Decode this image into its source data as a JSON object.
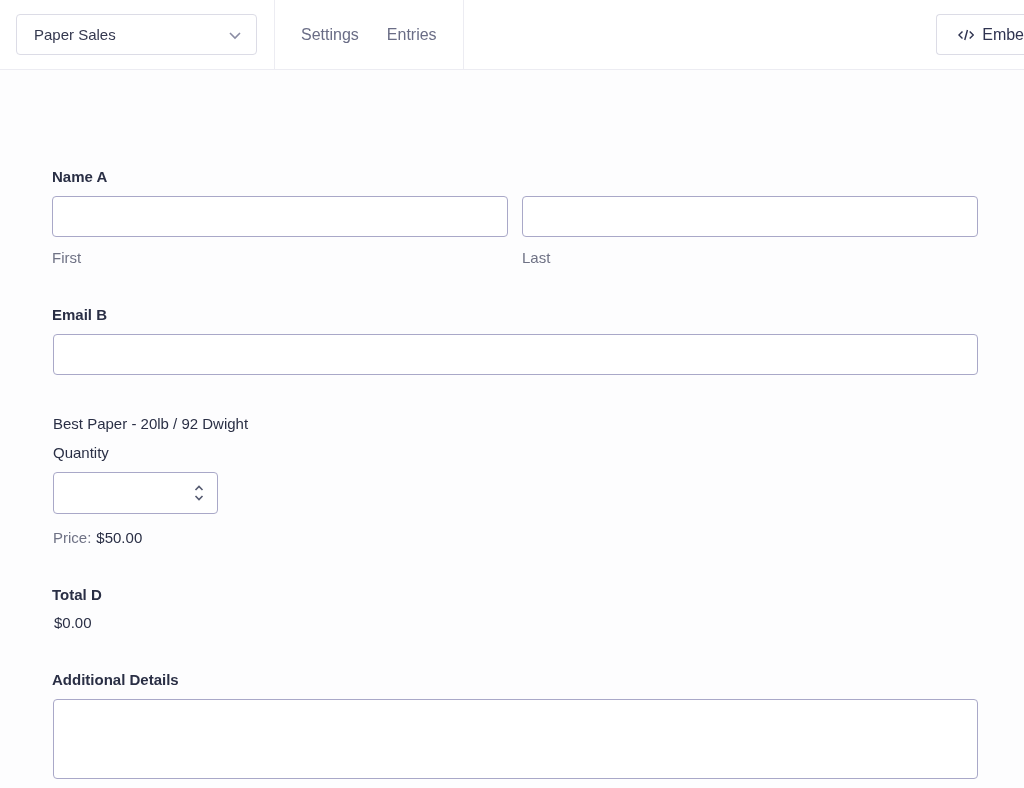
{
  "header": {
    "form_select": {
      "value": "Paper Sales"
    },
    "tabs": [
      {
        "label": "Settings",
        "selected": false
      },
      {
        "label": "Entries",
        "selected": false
      }
    ],
    "embed_button": {
      "label": "Embe"
    }
  },
  "fields": [
    {
      "kind": "name",
      "label": "Name A",
      "parts": [
        {
          "sublabel": "First"
        },
        {
          "sublabel": "Last"
        }
      ]
    },
    {
      "kind": "email",
      "label": "Email B"
    },
    {
      "kind": "product",
      "label": "Best Paper - 20lb / 92 Dwight",
      "quantity_label": "Quantity",
      "price_label": "Price:",
      "price": "$50.00"
    },
    {
      "kind": "total",
      "label": "Total D",
      "value": "$0.00"
    },
    {
      "kind": "textarea",
      "label": "Additional Details"
    }
  ]
}
